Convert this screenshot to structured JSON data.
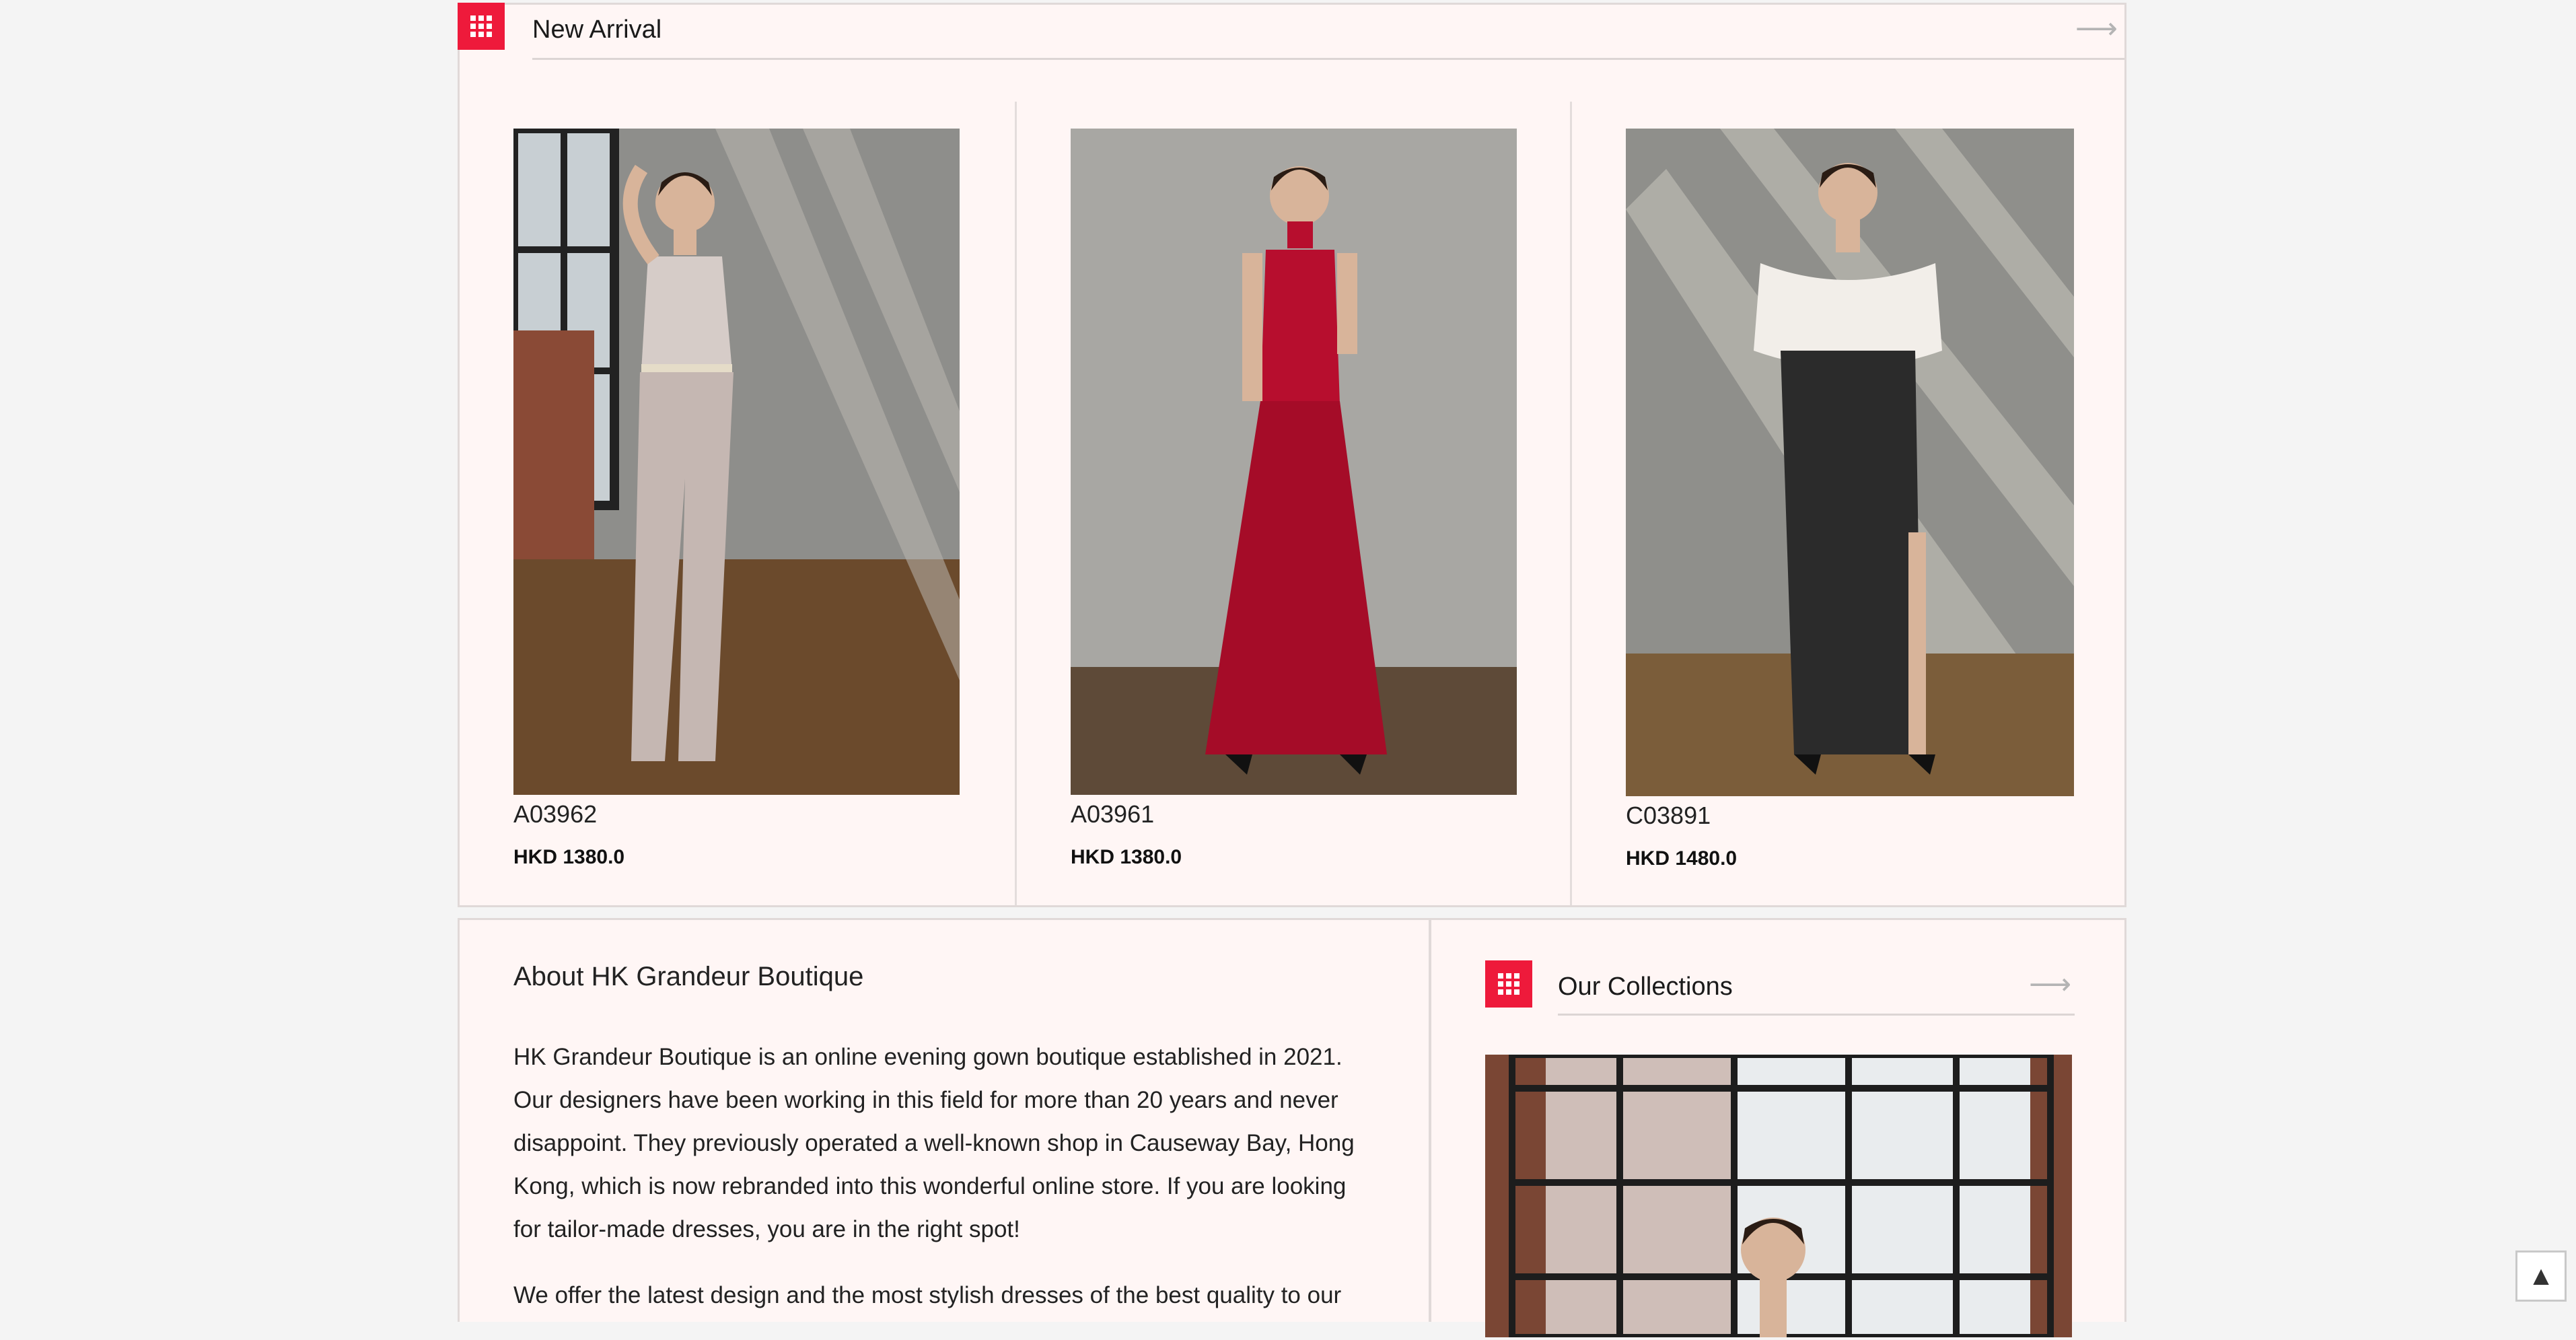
{
  "new_arrival": {
    "title": "New Arrival",
    "arrow_icon": "arrow-right-icon",
    "section_icon": "grid-icon",
    "products": [
      {
        "code": "A03962",
        "price": "HKD 1380.0",
        "garment": "champagne satin jumpsuit",
        "garment_color": "#c5b7b2"
      },
      {
        "code": "A03961",
        "price": "HKD 1380.0",
        "garment": "red halter gown",
        "garment_color": "#b70e2e"
      },
      {
        "code": "C03891",
        "price": "HKD 1480.0",
        "garment": "off-shoulder white and black gown",
        "garment_color": "#2b2b2b"
      }
    ]
  },
  "about": {
    "title": "About HK Grandeur Boutique",
    "paragraph_1": "HK Grandeur Boutique is an online evening gown boutique established in 2021.  Our designers have been working in this field for more than 20 years and never disappoint.  They previously operated a well-known shop in Causeway Bay, Hong Kong, which is now rebranded into this wonderful online store.  If you are looking for tailor-made dresses, you are in the right spot!",
    "paragraph_2": "We offer the latest design and the most stylish dresses of the best quality to our"
  },
  "collections": {
    "title": "Our Collections",
    "arrow_icon": "arrow-right-icon",
    "section_icon": "grid-icon"
  },
  "back_to_top": {
    "icon": "chevron-up-icon",
    "glyph": "▲"
  },
  "colors": {
    "accent": "#ee1a3b",
    "panel_background": "#fff6f5",
    "page_background": "#f4f4f4"
  }
}
